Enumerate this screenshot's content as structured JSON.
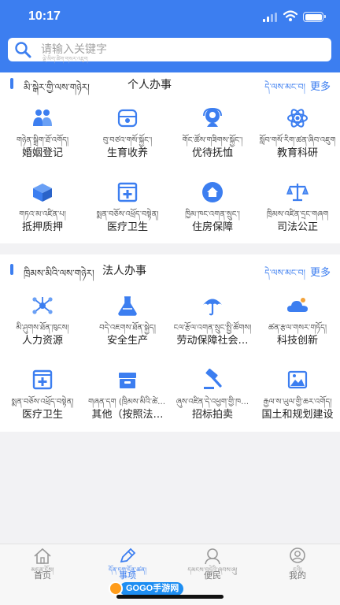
{
  "status_bar": {
    "time": "10:17"
  },
  "search": {
    "placeholder": "请输入关键字",
    "placeholder_tibetan": "ལྡེ་མིག་ཚིག་གསར་འཇུག"
  },
  "personal": {
    "title_tibetan": "མི་སྒེར་གྱི་ལས་གཉེར།",
    "title": "个人办事",
    "more_tibetan": "དེ་ལས་མང་བ།",
    "more": "更多",
    "items": [
      {
        "icon": "marriage-icon",
        "tibetan": "གཉེན་སྒྲིག་ཐོ་འགོད།",
        "label": "婚姻登记"
      },
      {
        "icon": "birth-icon",
        "tibetan": "བུ་བཙའ་གསོ་སྐྱོང་།",
        "label": "生育收养"
      },
      {
        "icon": "care-icon",
        "tibetan": "གོང་ཚོས་གཟིགས་སྐྱོང་།",
        "label": "优待抚恤"
      },
      {
        "icon": "education-icon",
        "tibetan": "སློབ་གསོ་རིག་ཚན་ཞིབ་འཇུག",
        "label": "教育科研"
      },
      {
        "icon": "mortgage-icon",
        "tibetan": "གཏའ་མ་འཛིན་པ།",
        "label": "抵押质押"
      },
      {
        "icon": "medical-icon",
        "tibetan": "སྨན་བཅོས་འཕྲོད་བསྟེན།",
        "label": "医疗卫生"
      },
      {
        "icon": "house-icon",
        "tibetan": "ཁྱིམ་ཁང་འགན་སྲུང་།",
        "label": "住房保障"
      },
      {
        "icon": "justice-icon",
        "tibetan": "ཁྲིམས་འཛིན་དྲང་གཞག",
        "label": "司法公正"
      }
    ]
  },
  "legal": {
    "title_tibetan": "ཁྲིམས་མིའི་ལས་གཉེར།",
    "title": "法人办事",
    "more_tibetan": "དེ་ལས་མང་བ།",
    "more": "更多",
    "items": [
      {
        "icon": "network-icon",
        "tibetan": "མི་ཤུགས་ཐོན་ཁུངས།",
        "label": "人力资源"
      },
      {
        "icon": "flask-icon",
        "tibetan": "བདེ་འཇགས་ཐོན་སྐྱེད།",
        "label": "安全生产"
      },
      {
        "icon": "umbrella-icon",
        "tibetan": "ངལ་རྩོལ་འགན་སྲུང་སྤྱི་ཚོགས།",
        "label": "劳动保障社会…"
      },
      {
        "icon": "innovation-icon",
        "tibetan": "ཚན་རྩལ་གསར་གཏོད།",
        "label": "科技创新"
      },
      {
        "icon": "medical-icon",
        "tibetan": "སྨན་བཅོས་འཕྲོད་བསྟེན།",
        "label": "医疗卫生"
      },
      {
        "icon": "box-icon",
        "tibetan": "གཞན་དག (ཁྲིམས་མིའི་ཚེ་…",
        "label": "其他（按照法…"
      },
      {
        "icon": "auction-icon",
        "tibetan": "ཞུས་འཛིན་དེ་འཕྱག་གྱི་ཁ…",
        "label": "招标拍卖"
      },
      {
        "icon": "landscape-icon",
        "tibetan": "རྒྱལ་ས་ཡུལ་གྱི་ཆར་འགོད།",
        "label": "国土和规划建设"
      }
    ]
  },
  "tabbar": {
    "tabs": [
      {
        "icon": "home-icon",
        "tibetan": "མདུན་ངོས།",
        "label": "首页",
        "active": false
      },
      {
        "icon": "pencil-icon",
        "tibetan": "དོན་དག་དོན་ཚན།",
        "label": "事项",
        "active": true
      },
      {
        "icon": "convenience-icon",
        "tibetan": "དམངས་བདེའི་ཞབས་ཞུ།",
        "label": "便民",
        "active": false
      },
      {
        "icon": "user-icon",
        "tibetan": "ངའི།",
        "label": "我的",
        "active": false
      }
    ]
  },
  "watermark": {
    "text": "GOGO手游网"
  },
  "colors": {
    "accent": "#3c7ef0",
    "page_bg": "#f2f2f4"
  }
}
